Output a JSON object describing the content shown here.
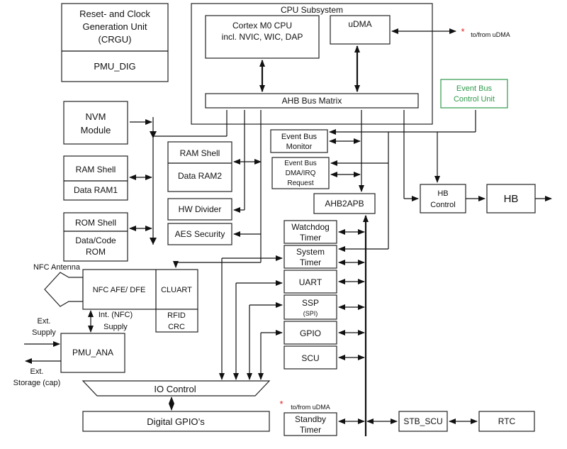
{
  "blocks": {
    "crgu": [
      "Reset- and Clock",
      "Generation Unit",
      "(CRGU)"
    ],
    "pmu_dig": "PMU_DIG",
    "cpu_subsystem": "CPU Subsystem",
    "cortex": [
      "Cortex M0 CPU",
      "incl. NVIC, WIC, DAP"
    ],
    "udma": "uDMA",
    "ahb_matrix": "AHB Bus Matrix",
    "event_bus_control": [
      "Event Bus",
      "Control Unit"
    ],
    "nvm": [
      "NVM",
      "Module"
    ],
    "ram_shell1": "RAM Shell",
    "data_ram1": "Data RAM1",
    "rom_shell": "ROM Shell",
    "data_code_rom": [
      "Data/Code",
      "ROM"
    ],
    "ram_shell2": "RAM Shell",
    "data_ram2": "Data RAM2",
    "hw_divider": "HW Divider",
    "aes": "AES Security",
    "event_bus_monitor": [
      "Event Bus",
      "Monitor"
    ],
    "event_bus_dma": [
      "Event Bus",
      "DMA/IRQ",
      "Request"
    ],
    "ahb2apb": "AHB2APB",
    "hb_control": [
      "HB",
      "Control"
    ],
    "hb": "HB",
    "watchdog": [
      "Watchdog",
      "Timer"
    ],
    "system_timer": [
      "System",
      "Timer"
    ],
    "uart": "UART",
    "ssp": "SSP",
    "ssp_sub": "(SPI)",
    "gpio": "GPIO",
    "scu": "SCU",
    "nfc_afe": "NFC AFE/ DFE",
    "cluart": "CLUART",
    "rfid_crc": [
      "RFID",
      "CRC"
    ],
    "pmu_ana": "PMU_ANA",
    "io_control": "IO Control",
    "digital_gpio": "Digital GPIO’s",
    "standby_timer": [
      "Standby",
      "Timer"
    ],
    "stb_scu": "STB_SCU",
    "rtc": "RTC"
  },
  "labels": {
    "to_from_udma_top": "to/from uDMA",
    "to_from_udma_bottom": "to/from uDMA",
    "asterisk": "*",
    "nfc_antenna": "NFC Antenna",
    "int_nfc_supply": [
      "Int. (NFC)",
      "Supply"
    ],
    "ext_supply": [
      "Ext.",
      "Supply"
    ],
    "ext_storage": [
      "Ext.",
      "Storage (cap)"
    ]
  },
  "colors": {
    "event_bus_control": "#2e9a4a",
    "asterisk": "#e02020"
  }
}
